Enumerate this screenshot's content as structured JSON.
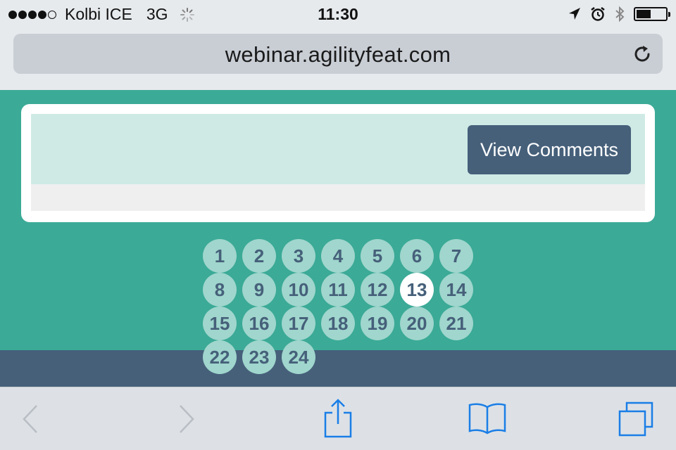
{
  "status_bar": {
    "carrier": "Kolbi ICE",
    "network": "3G",
    "time": "11:30",
    "signal_bars_filled": 4,
    "signal_bars_total": 5,
    "battery_level": 0.5
  },
  "address_bar": {
    "url": "webinar.agilityfeat.com"
  },
  "card": {
    "view_comments_label": "View Comments"
  },
  "pagination": {
    "pages": [
      "1",
      "2",
      "3",
      "4",
      "5",
      "6",
      "7",
      "8",
      "9",
      "10",
      "11",
      "12",
      "13",
      "14",
      "15",
      "16",
      "17",
      "18",
      "19",
      "20",
      "21",
      "22",
      "23",
      "24"
    ],
    "active": "13"
  },
  "colors": {
    "teal_background": "#3baa97",
    "page_circle": "#a0d6cd",
    "dark_slate": "#46607a",
    "ios_blue": "#1a7ee6"
  },
  "toolbar": {
    "icons": [
      "back-icon",
      "forward-icon",
      "share-icon",
      "bookmarks-icon",
      "tabs-icon"
    ]
  }
}
